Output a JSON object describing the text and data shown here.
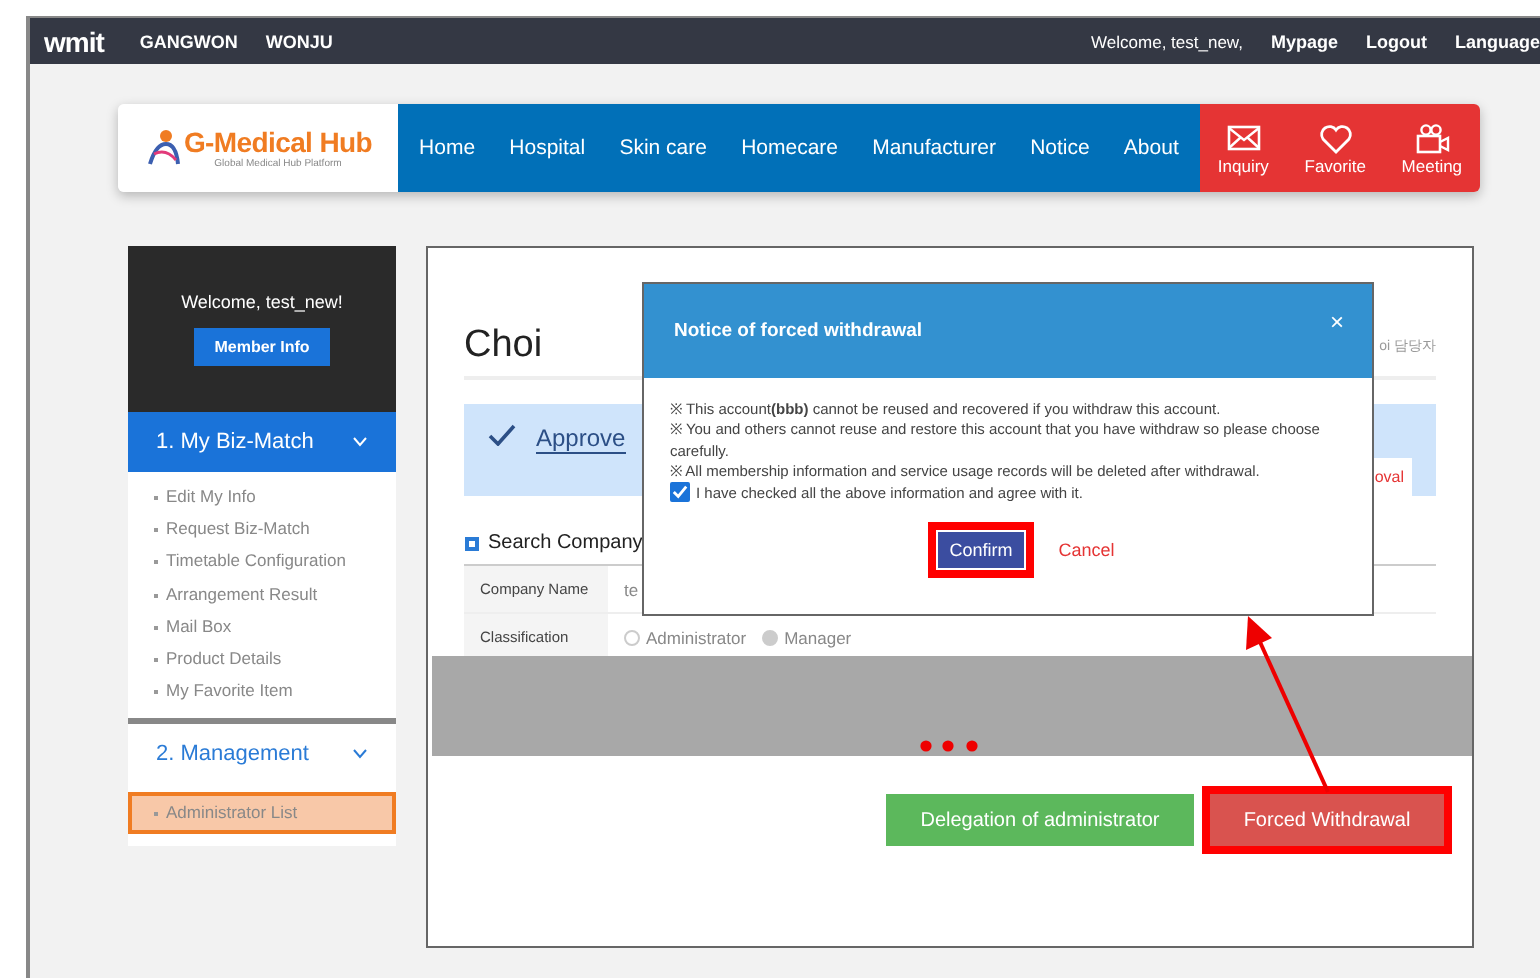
{
  "top_bar": {
    "logo": "wmit",
    "regions": [
      "GANGWON",
      "WONJU"
    ],
    "welcome": "Welcome, test_new,",
    "links": [
      "Mypage",
      "Logout",
      "Language"
    ]
  },
  "brand": {
    "name": "G-Medical Hub",
    "tagline": "Global Medical Hub Platform"
  },
  "nav": [
    "Home",
    "Hospital",
    "Skin care",
    "Homecare",
    "Manufacturer",
    "Notice",
    "About"
  ],
  "quick_links": [
    {
      "label": "Inquiry",
      "kind": "mail"
    },
    {
      "label": "Favorite",
      "kind": "heart"
    },
    {
      "label": "Meeting",
      "kind": "camera"
    }
  ],
  "sidebar": {
    "welcome": "Welcome, test_new!",
    "member_button": "Member Info",
    "sections": [
      {
        "title": "1. My Biz-Match",
        "selected": true,
        "items": [
          {
            "label": "Edit My Info",
            "selected": false
          },
          {
            "label": "Request Biz-Match",
            "selected": false
          },
          {
            "label": "Timetable Configuration",
            "selected": false
          },
          {
            "label": "Arrangement Result",
            "selected": false
          },
          {
            "label": "Mail Box",
            "selected": false
          },
          {
            "label": "Product Details",
            "selected": false
          },
          {
            "label": "My Favorite Item",
            "selected": false
          }
        ]
      },
      {
        "title": "2. Management",
        "selected": false,
        "items": [
          {
            "label": "Administrator List",
            "selected": true
          }
        ]
      }
    ]
  },
  "content": {
    "title": "Choi",
    "title_note": "oi 담당자",
    "approved": "Approve",
    "approved_action": "oval",
    "search_heading": "Search Company",
    "company_label": "Company Name",
    "company_value": "te",
    "classification_label": "Classification",
    "classification_options": [
      {
        "label": "Administrator",
        "selected": false
      },
      {
        "label": "Manager",
        "selected": true
      }
    ],
    "buttons": [
      {
        "label": "Delegation of administrator",
        "kind": "success",
        "highlighted": false
      },
      {
        "label": "Forced Withdrawal",
        "kind": "danger",
        "highlighted": true
      }
    ]
  },
  "modal": {
    "title": "Notice of forced withdrawal",
    "close": "×",
    "notes": [
      "※ This account**(bbb)** cannot be reused and recovered if you withdraw this account.",
      "※ You and others cannot reuse and restore this account that you have withdraw so please choose carefully.",
      "※ All membership information and service usage records will be deleted after withdrawal."
    ],
    "agree": {
      "label": "I have checked all the above information and agree with it.",
      "checked": true
    },
    "confirm": {
      "label": "Confirm",
      "highlighted": true
    },
    "cancel": "Cancel"
  }
}
